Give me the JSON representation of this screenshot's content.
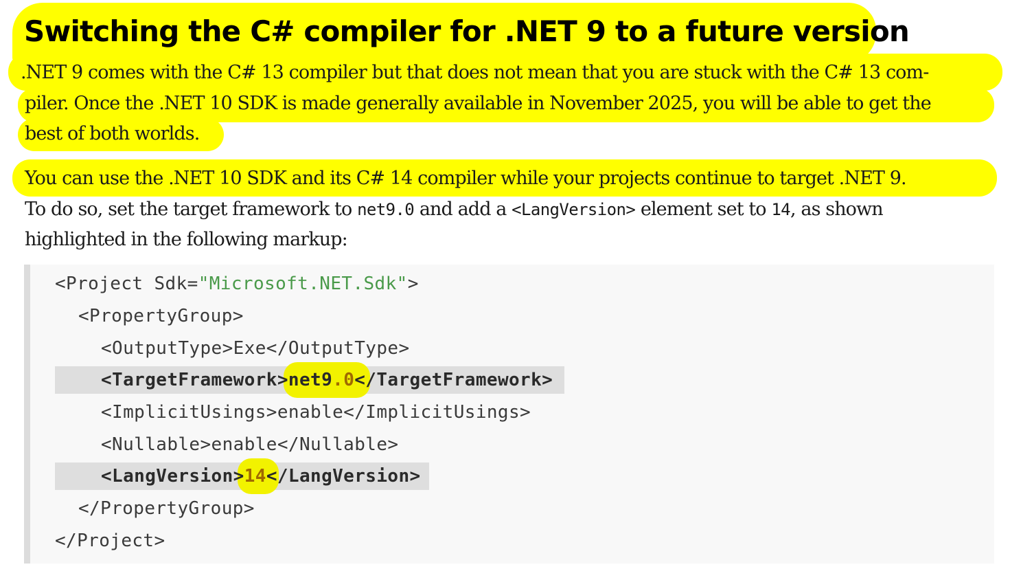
{
  "heading": "Switching the C# compiler for .NET 9 to a future version",
  "paragraph1": {
    "line1": ".NET 9 comes with the C# 13 compiler but that does not mean that you are stuck with the C# 13 com-",
    "line2": "piler. Once the .NET 10 SDK is made generally available in November 2025, you will be able to get the",
    "line3": "best of both worlds."
  },
  "paragraph2": {
    "line1": "You can use the .NET 10 SDK and its C# 14 compiler while your projects continue to target .NET 9.",
    "line2_a": "To do so, set the target framework to ",
    "line2_code1": "net9.0",
    "line2_b": " and add a ",
    "line2_code2": "<LangVersion>",
    "line2_c": " element set to ",
    "line2_code3": "14",
    "line2_d": ", as shown",
    "line3": "highlighted in the following markup:"
  },
  "code": {
    "l1_a": "<Project Sdk=",
    "l1_str": "\"Microsoft.NET.Sdk\"",
    "l1_b": ">",
    "l2": "<PropertyGroup>",
    "l3": "<OutputType>Exe</OutputType>",
    "l4_a": "<TargetFramework>",
    "l4_val": "net9",
    "l4_num": ".0",
    "l4_b": "</TargetFramework>",
    "l5": "<ImplicitUsings>enable</ImplicitUsings>",
    "l6": "<Nullable>enable</Nullable>",
    "l7_a": "<LangVersion>",
    "l7_num": "14",
    "l7_b": "</LangVersion>",
    "l8": "</PropertyGroup>",
    "l9": "</Project>"
  },
  "colors": {
    "highlight": "#ffff00",
    "code_background": "#f8f8f8",
    "code_string": "#4a9a4a",
    "code_number": "#a06a00"
  }
}
